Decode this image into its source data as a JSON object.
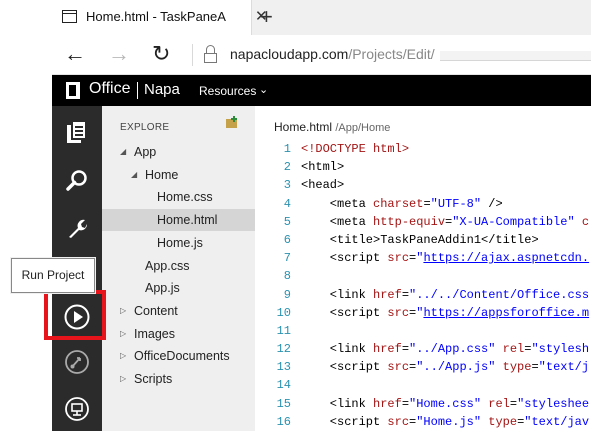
{
  "browser": {
    "tab_title": "Home.html - TaskPaneA",
    "tab_close": "✕",
    "new_tab": "+",
    "url_host": "napacloudapp.com",
    "url_path": "/Projects/Edit/"
  },
  "office": {
    "name": "Office",
    "product": "Napa",
    "resources_label": "Resources",
    "resources_chevron": "⌄"
  },
  "iconbar": {
    "items": [
      "explorer-icon",
      "search-icon",
      "wrench-icon",
      "run-icon",
      "publish-icon",
      "deploy-icon"
    ]
  },
  "tooltip": {
    "text": "Run Project"
  },
  "explorer": {
    "title": "EXPLORE",
    "items": [
      {
        "label": "App",
        "indent": 1,
        "expanded": true
      },
      {
        "label": "Home",
        "indent": 2,
        "expanded": true
      },
      {
        "label": "Home.css",
        "indent": 3
      },
      {
        "label": "Home.html",
        "indent": 3,
        "selected": true
      },
      {
        "label": "Home.js",
        "indent": 3
      },
      {
        "label": "App.css",
        "indent": 2
      },
      {
        "label": "App.js",
        "indent": 2
      },
      {
        "label": "Content",
        "indent": 1,
        "expanded": false
      },
      {
        "label": "Images",
        "indent": 1,
        "expanded": false
      },
      {
        "label": "OfficeDocuments",
        "indent": 1,
        "expanded": false
      },
      {
        "label": "Scripts",
        "indent": 1,
        "expanded": false
      }
    ]
  },
  "editor": {
    "file": "Home.html",
    "path": "/App/Home",
    "line_numbers": [
      "1",
      "2",
      "3",
      "4",
      "5",
      "6",
      "7",
      "8",
      "9",
      "10",
      "11",
      "12",
      "13",
      "14",
      "15",
      "16"
    ]
  }
}
